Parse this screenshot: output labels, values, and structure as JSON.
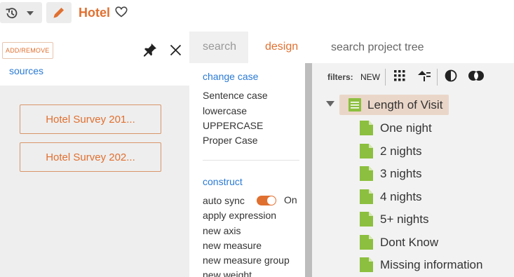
{
  "header": {
    "title": "Hotel"
  },
  "left_panel": {
    "add_remove_label": "ADD/REMOVE",
    "sources_label": "sources",
    "sources": [
      "Hotel Survey 201...",
      "Hotel Survey 202..."
    ]
  },
  "mid_panel": {
    "tabs": {
      "search": "search",
      "design": "design"
    },
    "change_case": {
      "title": "change case",
      "options": [
        "Sentence case",
        "lowercase",
        "UPPERCASE",
        "Proper Case"
      ]
    },
    "construct": {
      "title": "construct",
      "auto_sync_label": "auto sync",
      "auto_sync_state": "On",
      "options": [
        "apply expression",
        "new axis",
        "new measure",
        "new measure group",
        "new weight"
      ]
    }
  },
  "right_panel": {
    "search_placeholder": "search project tree",
    "filters_label": "filters:",
    "new_label": "NEW",
    "tree": {
      "root": "Length of Visit",
      "children": [
        "One night",
        "2 nights",
        "3 nights",
        "4 nights",
        "5+ nights",
        "Dont Know",
        "Missing information"
      ]
    }
  },
  "colors": {
    "accent": "#e07030",
    "link": "#2a7ad4",
    "leaf_icon": "#8cbf3f",
    "root_highlight": "#ead6c8"
  }
}
